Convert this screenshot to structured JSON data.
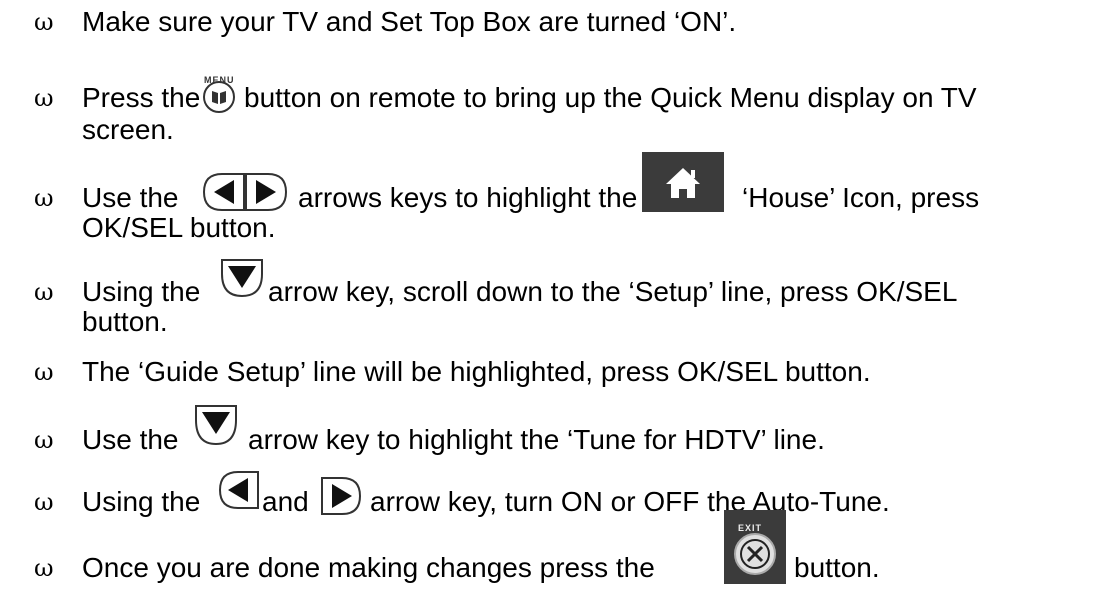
{
  "bullet": "ω",
  "steps": [
    {
      "text": "Make sure your TV and Set Top Box are turned ‘ON’."
    },
    {
      "before": "Press the",
      "after": "button on remote to bring up the Quick Menu display on TV",
      "cont": "screen.",
      "icon": "menu-icon",
      "icon_label": "MENU"
    },
    {
      "before": "Use the",
      "mid": "arrows keys to highlight the",
      "after": "‘House’ Icon, press",
      "cont": "OK/SEL button.",
      "icons": [
        "left-arrow-icon",
        "right-arrow-icon",
        "house-icon"
      ]
    },
    {
      "before": "Using the",
      "after": "arrow key, scroll down to the ‘Setup’ line, press OK/SEL",
      "cont": "button.",
      "icon": "down-arrow-icon"
    },
    {
      "text": "The ‘Guide Setup’ line will be highlighted, press OK/SEL button."
    },
    {
      "before": "Use the",
      "after": "arrow key to highlight the ‘Tune for HDTV’ line.",
      "icon": "down-arrow-icon"
    },
    {
      "before": "Using the",
      "mid": "and",
      "after": "arrow key, turn ON or OFF the Auto-Tune.",
      "icons": [
        "left-arrow-icon",
        "right-arrow-icon"
      ]
    },
    {
      "before": "Once you are done making changes press the",
      "after": "button.",
      "icon": "exit-icon",
      "icon_label": "EXIT"
    }
  ],
  "colors": {
    "text": "#000000",
    "icon_outline": "#333333",
    "house_bg": "#3b3b3b"
  }
}
